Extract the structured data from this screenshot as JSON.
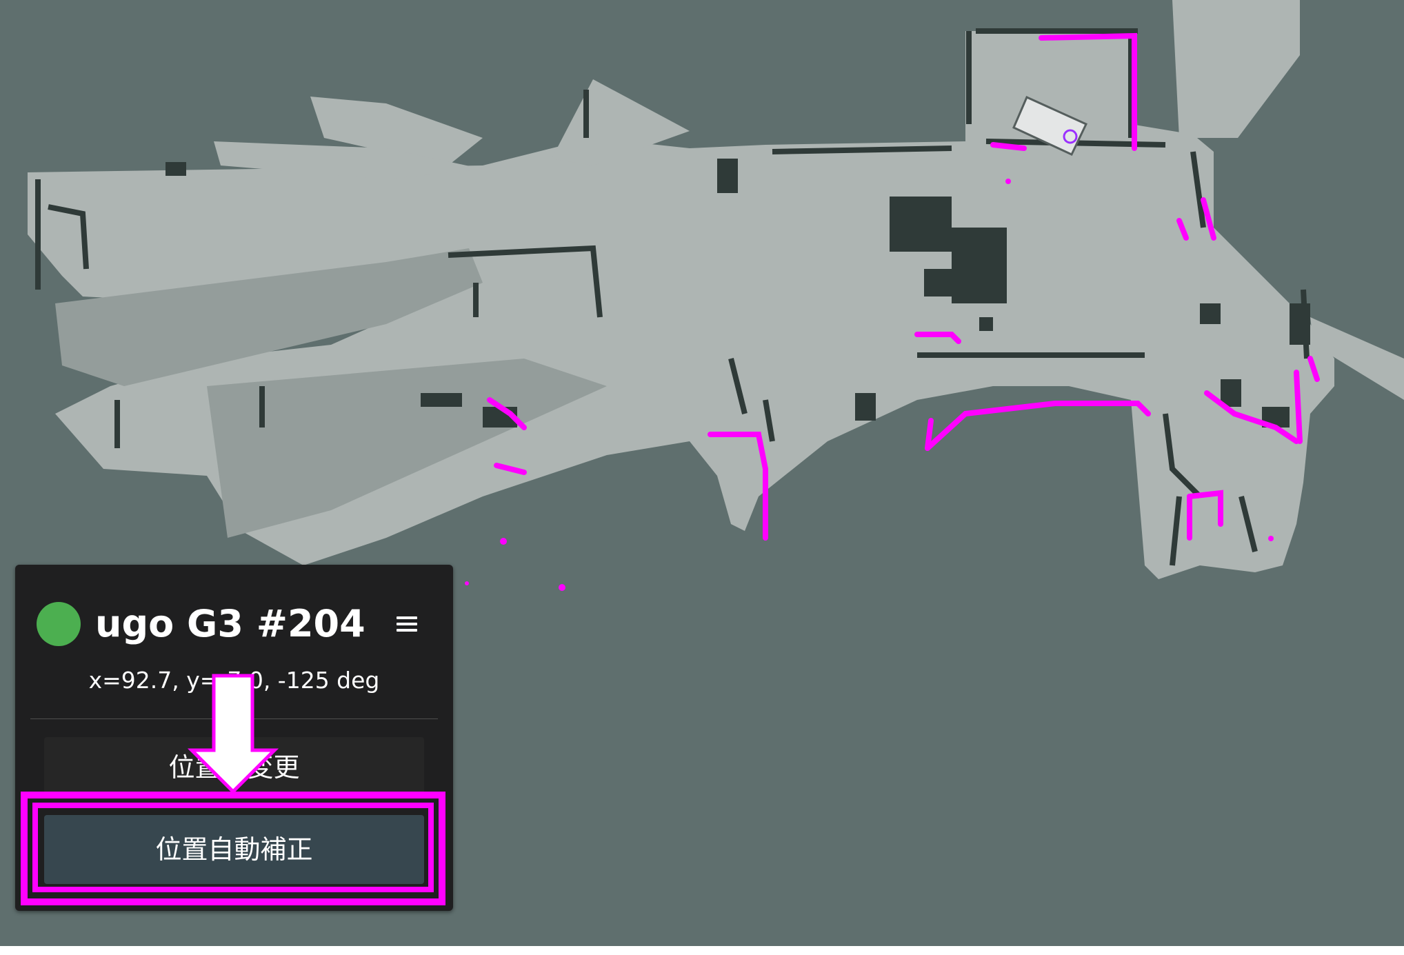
{
  "colors": {
    "map_background": "#5f6f6e",
    "free_space": "#aeb5b3",
    "obstacle": "#2f3a38",
    "lidar_scan": "#ff00ff",
    "panel_background": "#1f1f20",
    "status_online": "#4caf50",
    "auto_button": "#37474f",
    "highlight": "#ff00ff"
  },
  "map": {
    "robot_marker_icon": "robot-footprint-icon"
  },
  "robot_panel": {
    "status_icon": "status-dot-icon",
    "name": "ugo G3 #204",
    "menu_icon": "hamburger-menu-icon",
    "pose": "x=92.7, y=-7.0, -125 deg",
    "change_position_label": "位置の変更",
    "auto_correct_label": "位置自動補正"
  },
  "annotation": {
    "arrow_icon": "down-arrow-icon"
  }
}
